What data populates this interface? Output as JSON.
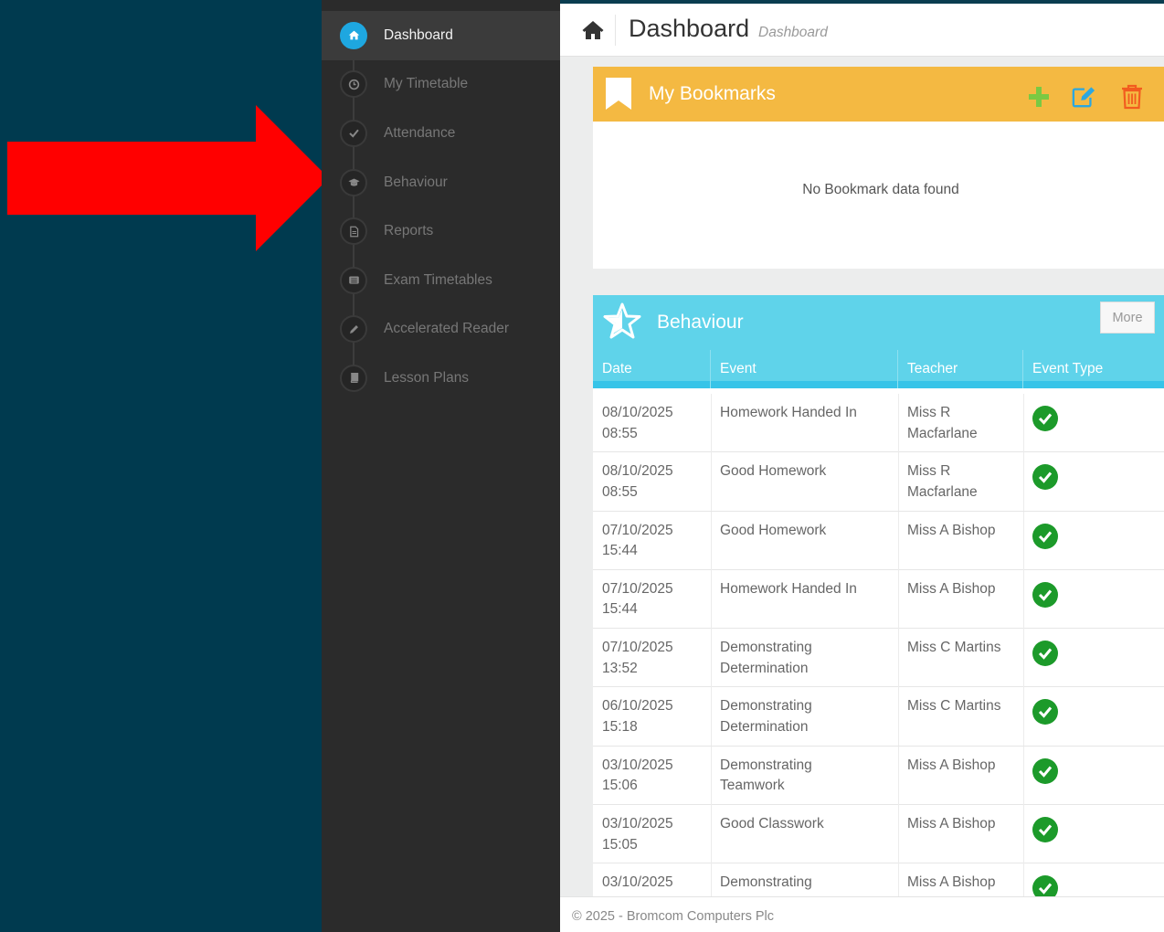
{
  "sidebar": {
    "items": [
      {
        "label": "Dashboard",
        "icon": "home-icon",
        "active": true
      },
      {
        "label": "My Timetable",
        "icon": "clock-icon"
      },
      {
        "label": "Attendance",
        "icon": "check-icon"
      },
      {
        "label": "Behaviour",
        "icon": "graduation-cap-icon"
      },
      {
        "label": "Reports",
        "icon": "document-icon"
      },
      {
        "label": "Exam Timetables",
        "icon": "list-icon"
      },
      {
        "label": "Accelerated Reader",
        "icon": "pencil-icon"
      },
      {
        "label": "Lesson Plans",
        "icon": "book-icon"
      }
    ]
  },
  "header": {
    "title": "Dashboard",
    "subtitle": "Dashboard"
  },
  "bookmarks": {
    "title": "My Bookmarks",
    "empty_text": "No Bookmark data found",
    "colors": {
      "header": "#f4b942",
      "add": "#7ac943",
      "edit": "#2ba7e0",
      "delete": "#f25c1f"
    }
  },
  "behaviour": {
    "title": "Behaviour",
    "more_label": "More",
    "columns": [
      "Date",
      "Event",
      "Teacher",
      "Event Type"
    ],
    "rows": [
      {
        "date": "08/10/2025",
        "time": "08:55",
        "event": "Homework Handed In",
        "event2": "",
        "teacher": "Miss R",
        "teacher2": "Macfarlane"
      },
      {
        "date": "08/10/2025",
        "time": "08:55",
        "event": "Good Homework",
        "event2": "",
        "teacher": "Miss R",
        "teacher2": "Macfarlane"
      },
      {
        "date": "07/10/2025",
        "time": "15:44",
        "event": "Good Homework",
        "event2": "",
        "teacher": "Miss A Bishop",
        "teacher2": ""
      },
      {
        "date": "07/10/2025",
        "time": "15:44",
        "event": "Homework Handed In",
        "event2": "",
        "teacher": "Miss A Bishop",
        "teacher2": ""
      },
      {
        "date": "07/10/2025",
        "time": "13:52",
        "event": "Demonstrating",
        "event2": "Determination",
        "teacher": "Miss C Martins",
        "teacher2": ""
      },
      {
        "date": "06/10/2025",
        "time": "15:18",
        "event": "Demonstrating",
        "event2": "Determination",
        "teacher": "Miss C Martins",
        "teacher2": ""
      },
      {
        "date": "03/10/2025",
        "time": "15:06",
        "event": "Demonstrating",
        "event2": "Teamwork",
        "teacher": "Miss A Bishop",
        "teacher2": ""
      },
      {
        "date": "03/10/2025",
        "time": "15:05",
        "event": "Good Classwork",
        "event2": "",
        "teacher": "Miss A Bishop",
        "teacher2": ""
      },
      {
        "date": "03/10/2025",
        "time": "",
        "event": "Demonstrating",
        "event2": "",
        "teacher": "Miss A Bishop",
        "teacher2": ""
      }
    ]
  },
  "footer": {
    "text": "© 2025 - Bromcom Computers Plc"
  },
  "colors": {
    "accent": "#1ea7e0",
    "behaviour_header": "#5fd3ea",
    "positive": "#1c9a2a",
    "arrow": "#ff0000"
  }
}
